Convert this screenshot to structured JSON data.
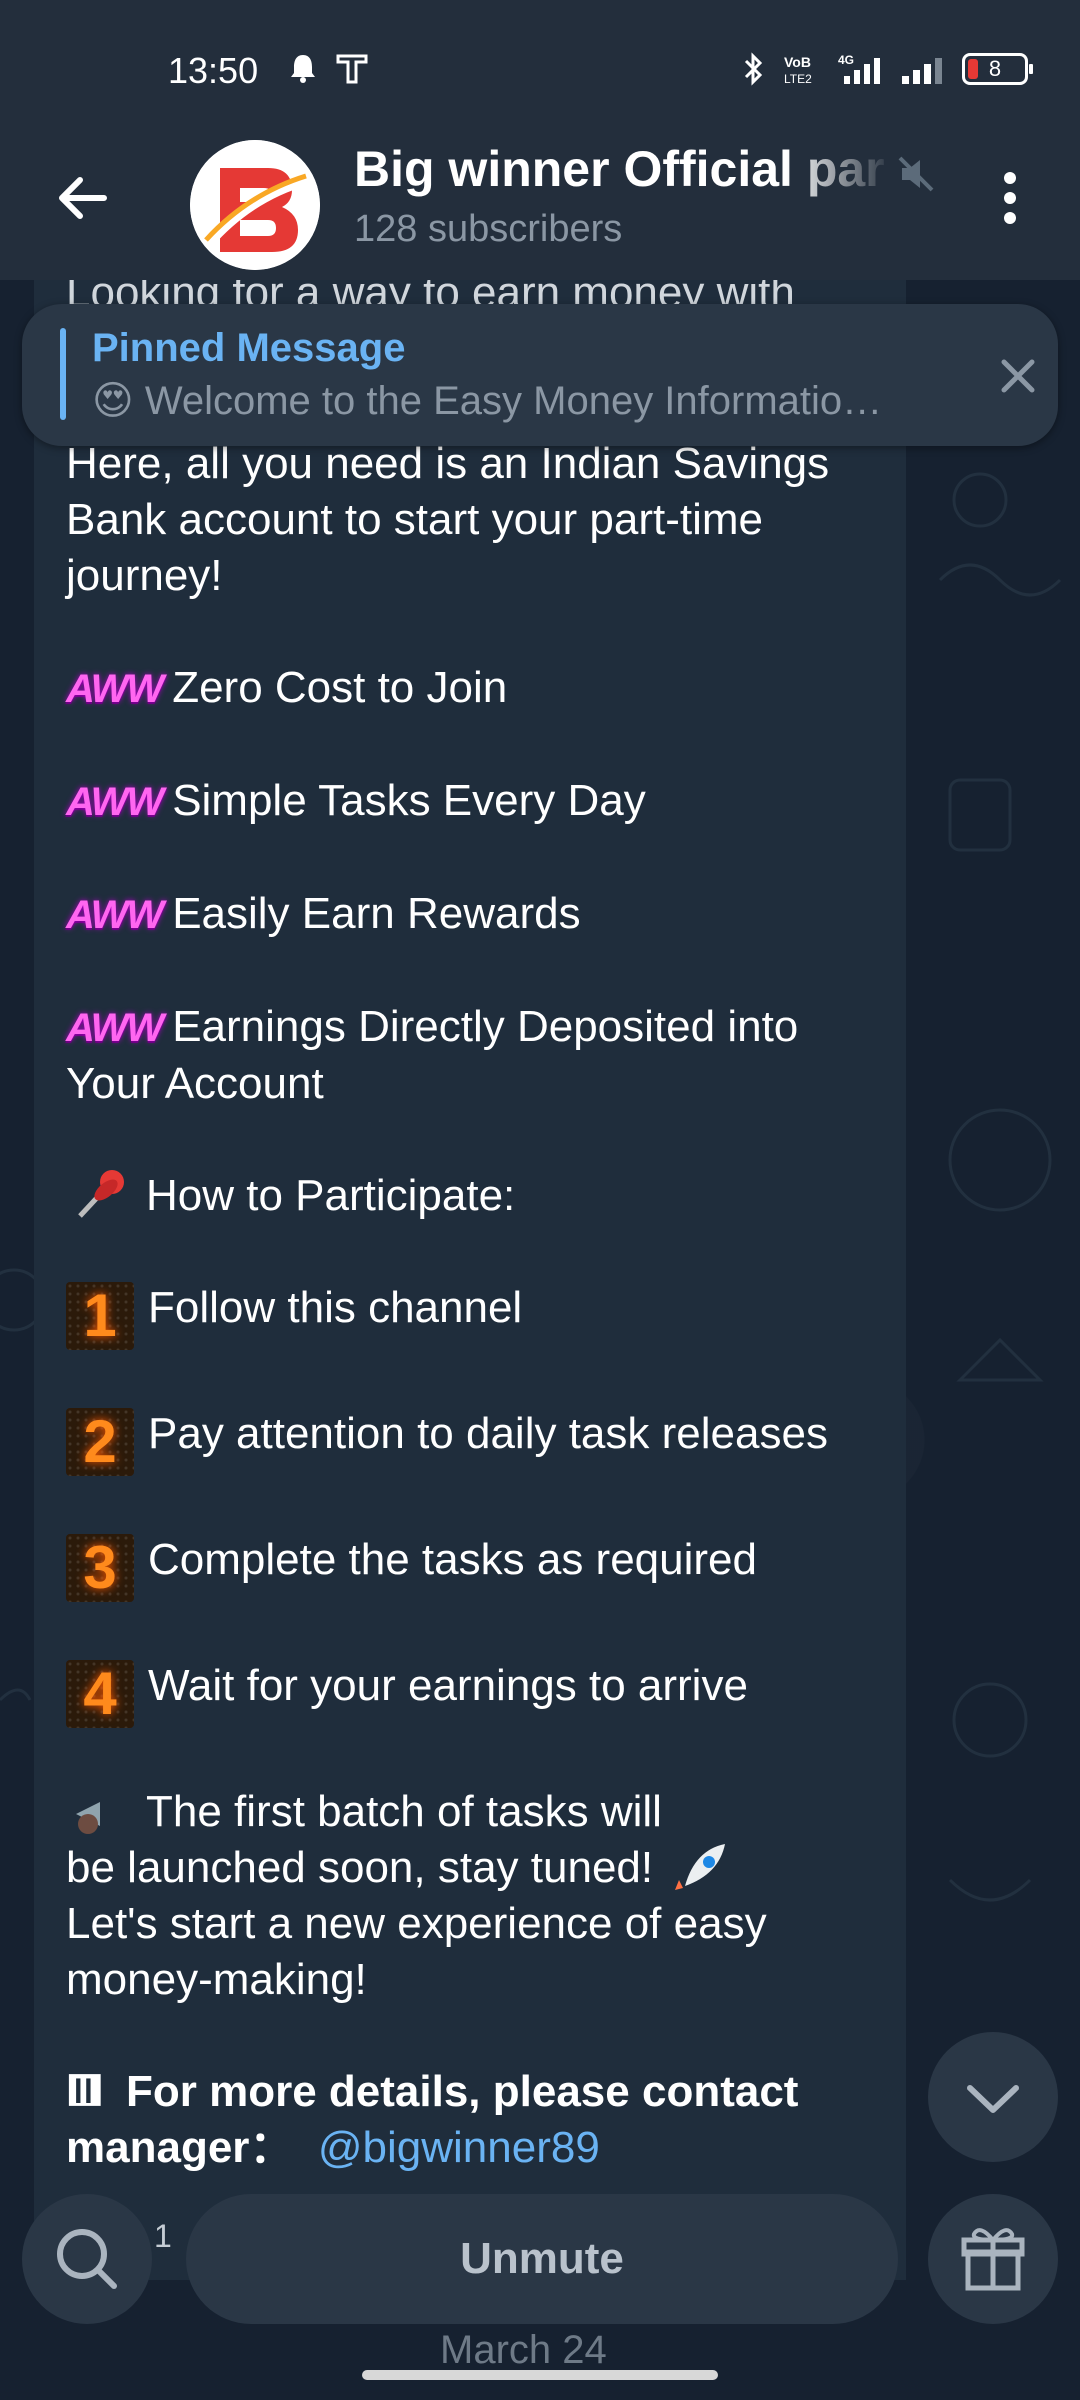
{
  "status_bar": {
    "time": "13:50",
    "battery": "8"
  },
  "header": {
    "channel_name": "Big winner Official par",
    "subscribers": "128 subscribers"
  },
  "pinned": {
    "title": "Pinned Message",
    "text": "Welcome to the Easy Money Informatio…"
  },
  "message": {
    "cut_top_line": "Looking for a way to earn money with",
    "intro": "Here, all you need is an Indian Savings Bank account to start your part-time journey!",
    "bullet_badge": "AWW",
    "benefits": [
      "Zero Cost to Join",
      "Simple Tasks Every Day",
      "Easily Earn Rewards",
      "Earnings Directly Deposited into Your Account"
    ],
    "how_to": "How to Participate:",
    "steps": [
      {
        "num": "1",
        "text": "Follow this channel"
      },
      {
        "num": "2",
        "text": "Pay attention to daily task releases"
      },
      {
        "num": "3",
        "text": "Complete the tasks as required"
      },
      {
        "num": "4",
        "text": "Wait for your earnings to arrive"
      }
    ],
    "announce_1": "The first batch of tasks will",
    "announce_2": "be launched soon, stay tuned!",
    "announce_3": "Let's start a new experience of easy money-making!",
    "contact_prefix": "For more details, please contact manager：",
    "contact_handle": "@bigwinner89"
  },
  "bottom": {
    "search_count": "1",
    "unmute_label": "Unmute",
    "date_chip": "March 24"
  },
  "colors": {
    "accent": "#6ab3f3",
    "header_bg": "#232e3c",
    "bubble_bg": "#1f2d3c"
  },
  "icons": [
    "back-arrow-icon",
    "mute-icon",
    "more-vert-icon",
    "close-icon",
    "chevron-down-icon",
    "search-icon",
    "gift-icon",
    "bluetooth-icon",
    "signal-icon",
    "battery-icon"
  ]
}
